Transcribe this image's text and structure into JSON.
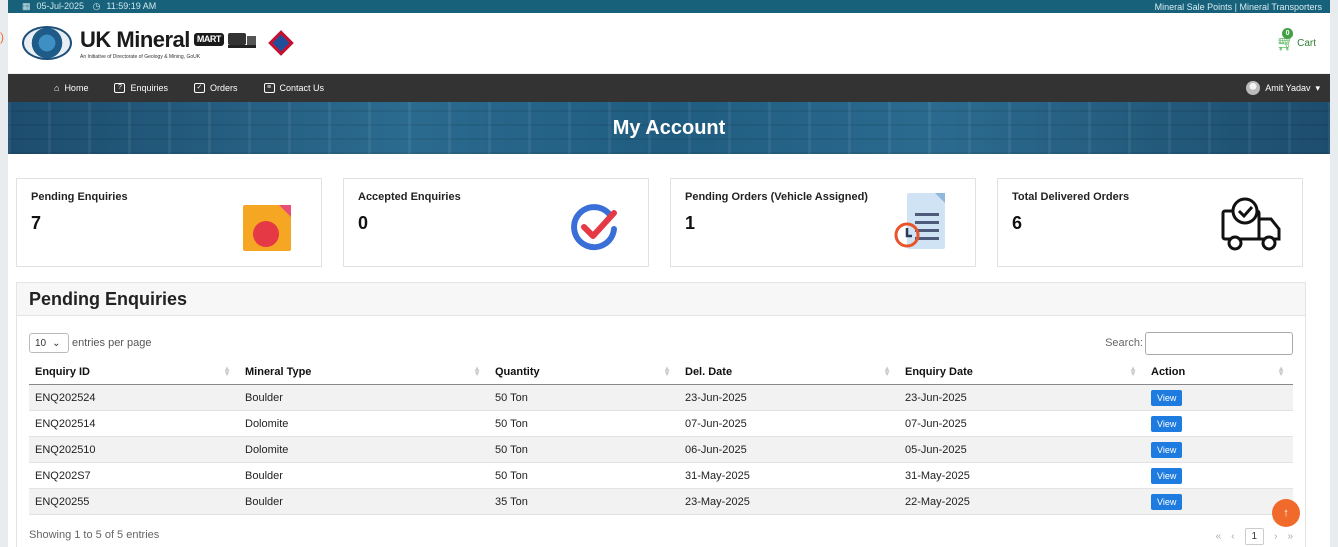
{
  "topbar": {
    "date": "05-Jul-2025",
    "time": "11:59:19 AM",
    "links": "Mineral Sale Points | Mineral Transporters"
  },
  "brand": {
    "logo_text": "UK Mineral",
    "mart_label": "MART",
    "tagline": "An Initiative of Directorate of Geology & Mining, GoUK",
    "cart_label": "Cart",
    "cart_count": "0"
  },
  "nav": {
    "items": [
      {
        "label": "Home",
        "icon": "home-icon"
      },
      {
        "label": "Enquiries",
        "icon": "question-icon"
      },
      {
        "label": "Orders",
        "icon": "clipboard-icon"
      },
      {
        "label": "Contact Us",
        "icon": "message-icon"
      }
    ],
    "user_name": "Amit Yadav"
  },
  "banner": {
    "title": "My Account"
  },
  "cards": [
    {
      "label": "Pending Enquiries",
      "value": "7",
      "icon": "document-icon"
    },
    {
      "label": "Accepted Enquiries",
      "value": "0",
      "icon": "check-icon"
    },
    {
      "label": "Pending Orders (Vehicle Assigned)",
      "value": "1",
      "icon": "clock-document-icon"
    },
    {
      "label": "Total Delivered Orders",
      "value": "6",
      "icon": "delivery-truck-icon"
    }
  ],
  "table_section": {
    "title": "Pending Enquiries",
    "per_page_value": "10",
    "per_page_label": "entries per page",
    "search_label": "Search:",
    "columns": [
      "Enquiry ID",
      "Mineral Type",
      "Quantity",
      "Del. Date",
      "Enquiry Date",
      "Action"
    ],
    "rows": [
      [
        "ENQ202524",
        "Boulder",
        "50 Ton",
        "23-Jun-2025",
        "23-Jun-2025",
        "View"
      ],
      [
        "ENQ202514",
        "Dolomite",
        "50 Ton",
        "07-Jun-2025",
        "07-Jun-2025",
        "View"
      ],
      [
        "ENQ202510",
        "Dolomite",
        "50 Ton",
        "06-Jun-2025",
        "05-Jun-2025",
        "View"
      ],
      [
        "ENQ202S7",
        "Boulder",
        "50 Ton",
        "31-May-2025",
        "31-May-2025",
        "View"
      ],
      [
        "ENQ20255",
        "Boulder",
        "35 Ton",
        "23-May-2025",
        "22-May-2025",
        "View"
      ]
    ],
    "info": "Showing 1 to 5 of 5 entries",
    "pager": {
      "first": "«",
      "prev": "‹",
      "current": "1",
      "next": "›",
      "last": "»"
    }
  },
  "colors": {
    "topbar": "#17627a",
    "nav": "#333333",
    "view_button": "#1e7be0",
    "to_top": "#f06b2b"
  }
}
